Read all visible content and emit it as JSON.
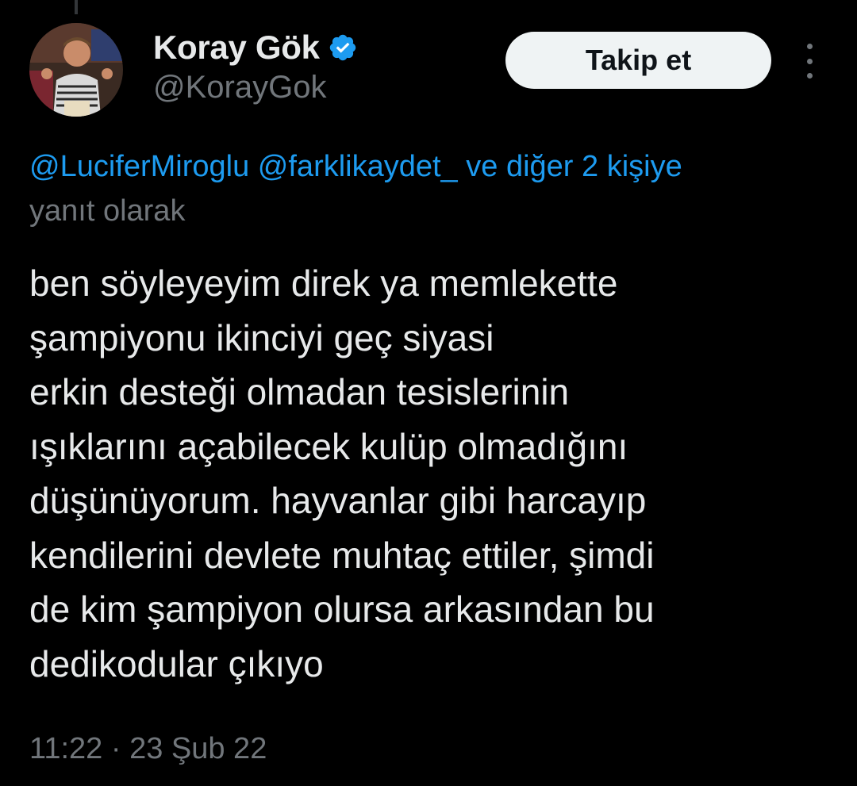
{
  "author": {
    "display_name": "Koray Gök",
    "handle": "@KorayGok",
    "verified": true,
    "avatar": "profile-photo"
  },
  "actions": {
    "follow_label": "Takip et",
    "more_icon": "more-vertical-icon"
  },
  "reply_context": {
    "mentions": [
      "@LuciferMiroglu",
      "@farklikaydet_"
    ],
    "others": "ve diğer 2 kişiye",
    "suffix": "yanıt olarak"
  },
  "tweet": {
    "text": "ben söyleyeyim direk ya memlekette\nşampiyonu ikinciyi geç siyasi\nerkin desteği olmadan tesislerinin\nışıklarını açabilecek kulüp olmadığını\ndüşünüyorum. hayvanlar gibi harcayıp\nkendilerini devlete muhtaç ettiler, şimdi\nde kim şampiyon olursa arkasından bu\ndedikodular çıkıyo",
    "time": "11:22",
    "separator": "·",
    "date": "23 Şub 22"
  },
  "colors": {
    "background": "#000000",
    "primary_text": "#e7e9ea",
    "secondary_text": "#71767b",
    "link": "#1d9bf0",
    "follow_button_bg": "#eff3f4",
    "verified_badge": "#1d9bf0"
  }
}
